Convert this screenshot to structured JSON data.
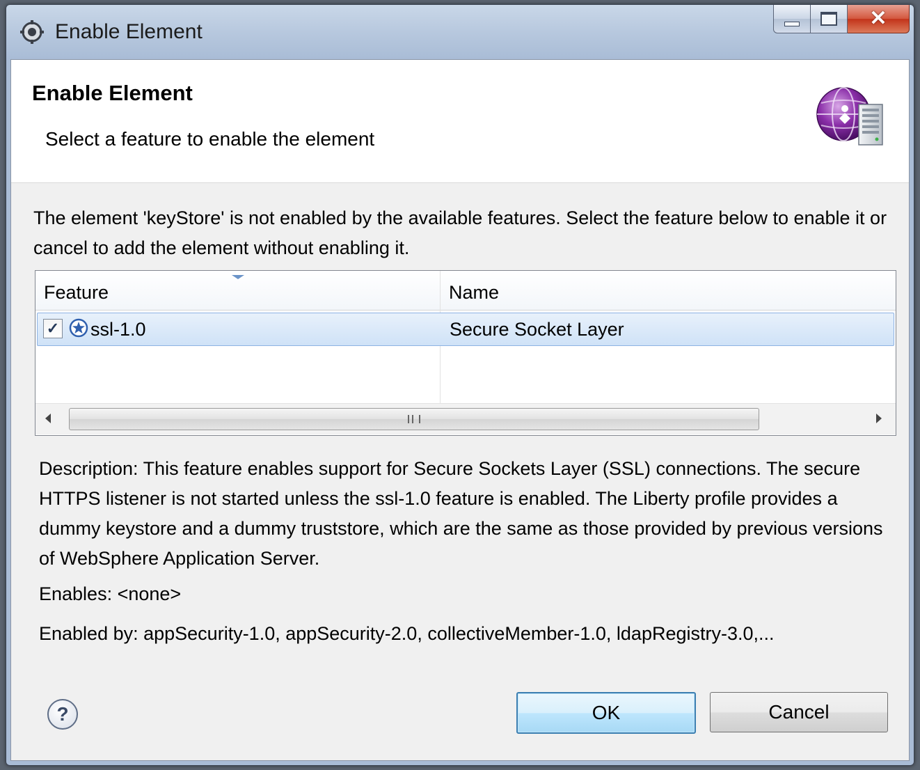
{
  "window": {
    "title": "Enable Element"
  },
  "banner": {
    "title": "Enable Element",
    "subtitle": "Select a feature to enable the element",
    "icon": "websphere-server-icon"
  },
  "intro": {
    "message": "The element 'keyStore' is not enabled by the available features.  Select the feature below to enable it or cancel to add the element without enabling it."
  },
  "table": {
    "columns": [
      "Feature",
      "Name"
    ],
    "rows": [
      {
        "checked": true,
        "feature": "ssl-1.0",
        "name": "Secure Socket Layer"
      }
    ]
  },
  "details": {
    "description": "Description: This feature enables support for Secure Sockets Layer (SSL) connections.  The secure HTTPS listener is not started unless the ssl-1.0 feature is enabled.  The Liberty profile provides a dummy keystore and a dummy truststore, which are the same as those provided by previous versions of WebSphere Application Server.",
    "enables": "Enables: <none>",
    "enabled_by": "Enabled by: appSecurity-1.0, appSecurity-2.0, collectiveMember-1.0, ldapRegistry-3.0,..."
  },
  "buttons": {
    "help": "?",
    "ok": "OK",
    "cancel": "Cancel"
  },
  "colors": {
    "selection": "#cfe2f7",
    "default_button_border": "#3c7fb1",
    "close_button": "#c2331a"
  }
}
